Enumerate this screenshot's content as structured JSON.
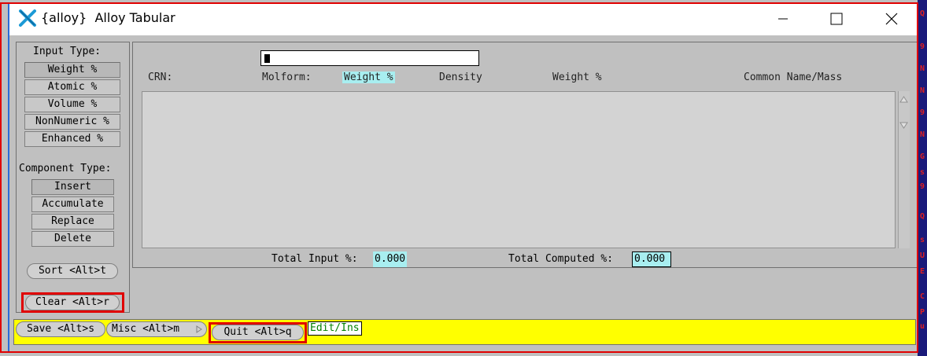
{
  "window": {
    "app_tag": "{alloy}",
    "title": "Alloy Tabular",
    "controls": {
      "minimize": "minimize-icon",
      "maximize": "maximize-icon",
      "close": "close-icon"
    }
  },
  "left": {
    "input_type_label": "Input Type:",
    "input_types": [
      "Weight %",
      "Atomic %",
      "Volume %",
      "NonNumeric %",
      "Enhanced %"
    ],
    "selected_input_type": "Weight %",
    "component_type_label": "Component Type:",
    "component_types": [
      "Insert",
      "Accumulate",
      "Replace",
      "Delete"
    ],
    "selected_component_type": "Insert",
    "sort_label": "Sort <Alt>t",
    "clear_label": "Clear <Alt>r"
  },
  "main": {
    "entry_value": "",
    "headers": {
      "crn": "CRN:",
      "molform": "Molform:",
      "weight_highlight": "Weight %",
      "density": "Density",
      "weight": "Weight %",
      "common_name": "Common Name/Mass"
    },
    "total_input_label": "Total Input %:",
    "total_input_value": "0.000",
    "total_computed_label": "Total Computed %:",
    "total_computed_value": "0.000"
  },
  "bottom": {
    "save_label": "Save <Alt>s",
    "misc_label": "Misc <Alt>m",
    "quit_label": "Quit <Alt>q",
    "mode": "Edit/Ins"
  },
  "colors": {
    "highlight": "#a8eef0",
    "status_bar": "#ffff00",
    "alert_red": "#e00000",
    "mode_text": "#008000"
  }
}
